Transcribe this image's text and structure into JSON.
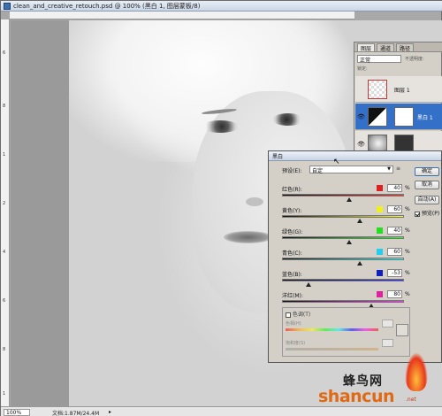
{
  "document": {
    "title": "clean_and_creative_retouch.psd @ 100% (黑白 1, 图层蒙板/8)",
    "zoom": "100%",
    "doc_size": "文档:1.87M/24.4M",
    "ruler_top": [
      "",
      "",
      "",
      "",
      "",
      "",
      "",
      "",
      ""
    ],
    "ruler_left": [
      "6",
      "8",
      "1",
      "2",
      "4",
      "6",
      "8",
      "1"
    ]
  },
  "layers_panel": {
    "tabs": [
      "图层",
      "通道",
      "路径"
    ],
    "blend_mode": "正常",
    "opacity_label": "不透明度:",
    "lock_label": "锁定:",
    "layers": [
      {
        "name": "图层 1",
        "thumb": "checker",
        "visible": false,
        "selected": false
      },
      {
        "name": "黑白 1",
        "thumb": "adjustment",
        "visible": true,
        "selected": true
      },
      {
        "name": "",
        "thumb": "photo",
        "visible": true,
        "selected": false
      }
    ]
  },
  "bw_dialog": {
    "title": "黑白",
    "preset_label": "预设(E):",
    "preset_value": "自定",
    "preset_menu_icon": "≡",
    "buttons": {
      "ok": "确定",
      "cancel": "取消",
      "auto": "自动(A)"
    },
    "preview_label": "预览(P)",
    "preview_checked": true,
    "sliders": [
      {
        "label": "红色(R):",
        "value": "40",
        "color": "#e02020",
        "track": "red",
        "level": 0.55
      },
      {
        "label": "黄色(Y):",
        "value": "60",
        "color": "#f0f020",
        "track": "yellow",
        "level": 0.64
      },
      {
        "label": "绿色(G):",
        "value": "40",
        "color": "#20e020",
        "track": "green",
        "level": 0.55
      },
      {
        "label": "青色(C):",
        "value": "60",
        "color": "#20d0f0",
        "track": "cyan",
        "level": 0.64
      },
      {
        "label": "蓝色(B):",
        "value": "-53",
        "color": "#1020c0",
        "track": "blue",
        "level": 0.22
      },
      {
        "label": "洋红(M):",
        "value": "80",
        "color": "#e020a0",
        "track": "magenta",
        "level": 0.73
      }
    ],
    "percent": "%",
    "tint": {
      "label": "色调(T)",
      "checked": false,
      "hue_label": "色相(H)",
      "sat_label": "饱和度(S)"
    }
  },
  "watermark": {
    "top": "蜂鸟网",
    "main": "shancun",
    "sub": ".net"
  },
  "colors": {
    "selected_layer": "#3470c8",
    "watermark_orange": "#e06a14"
  }
}
